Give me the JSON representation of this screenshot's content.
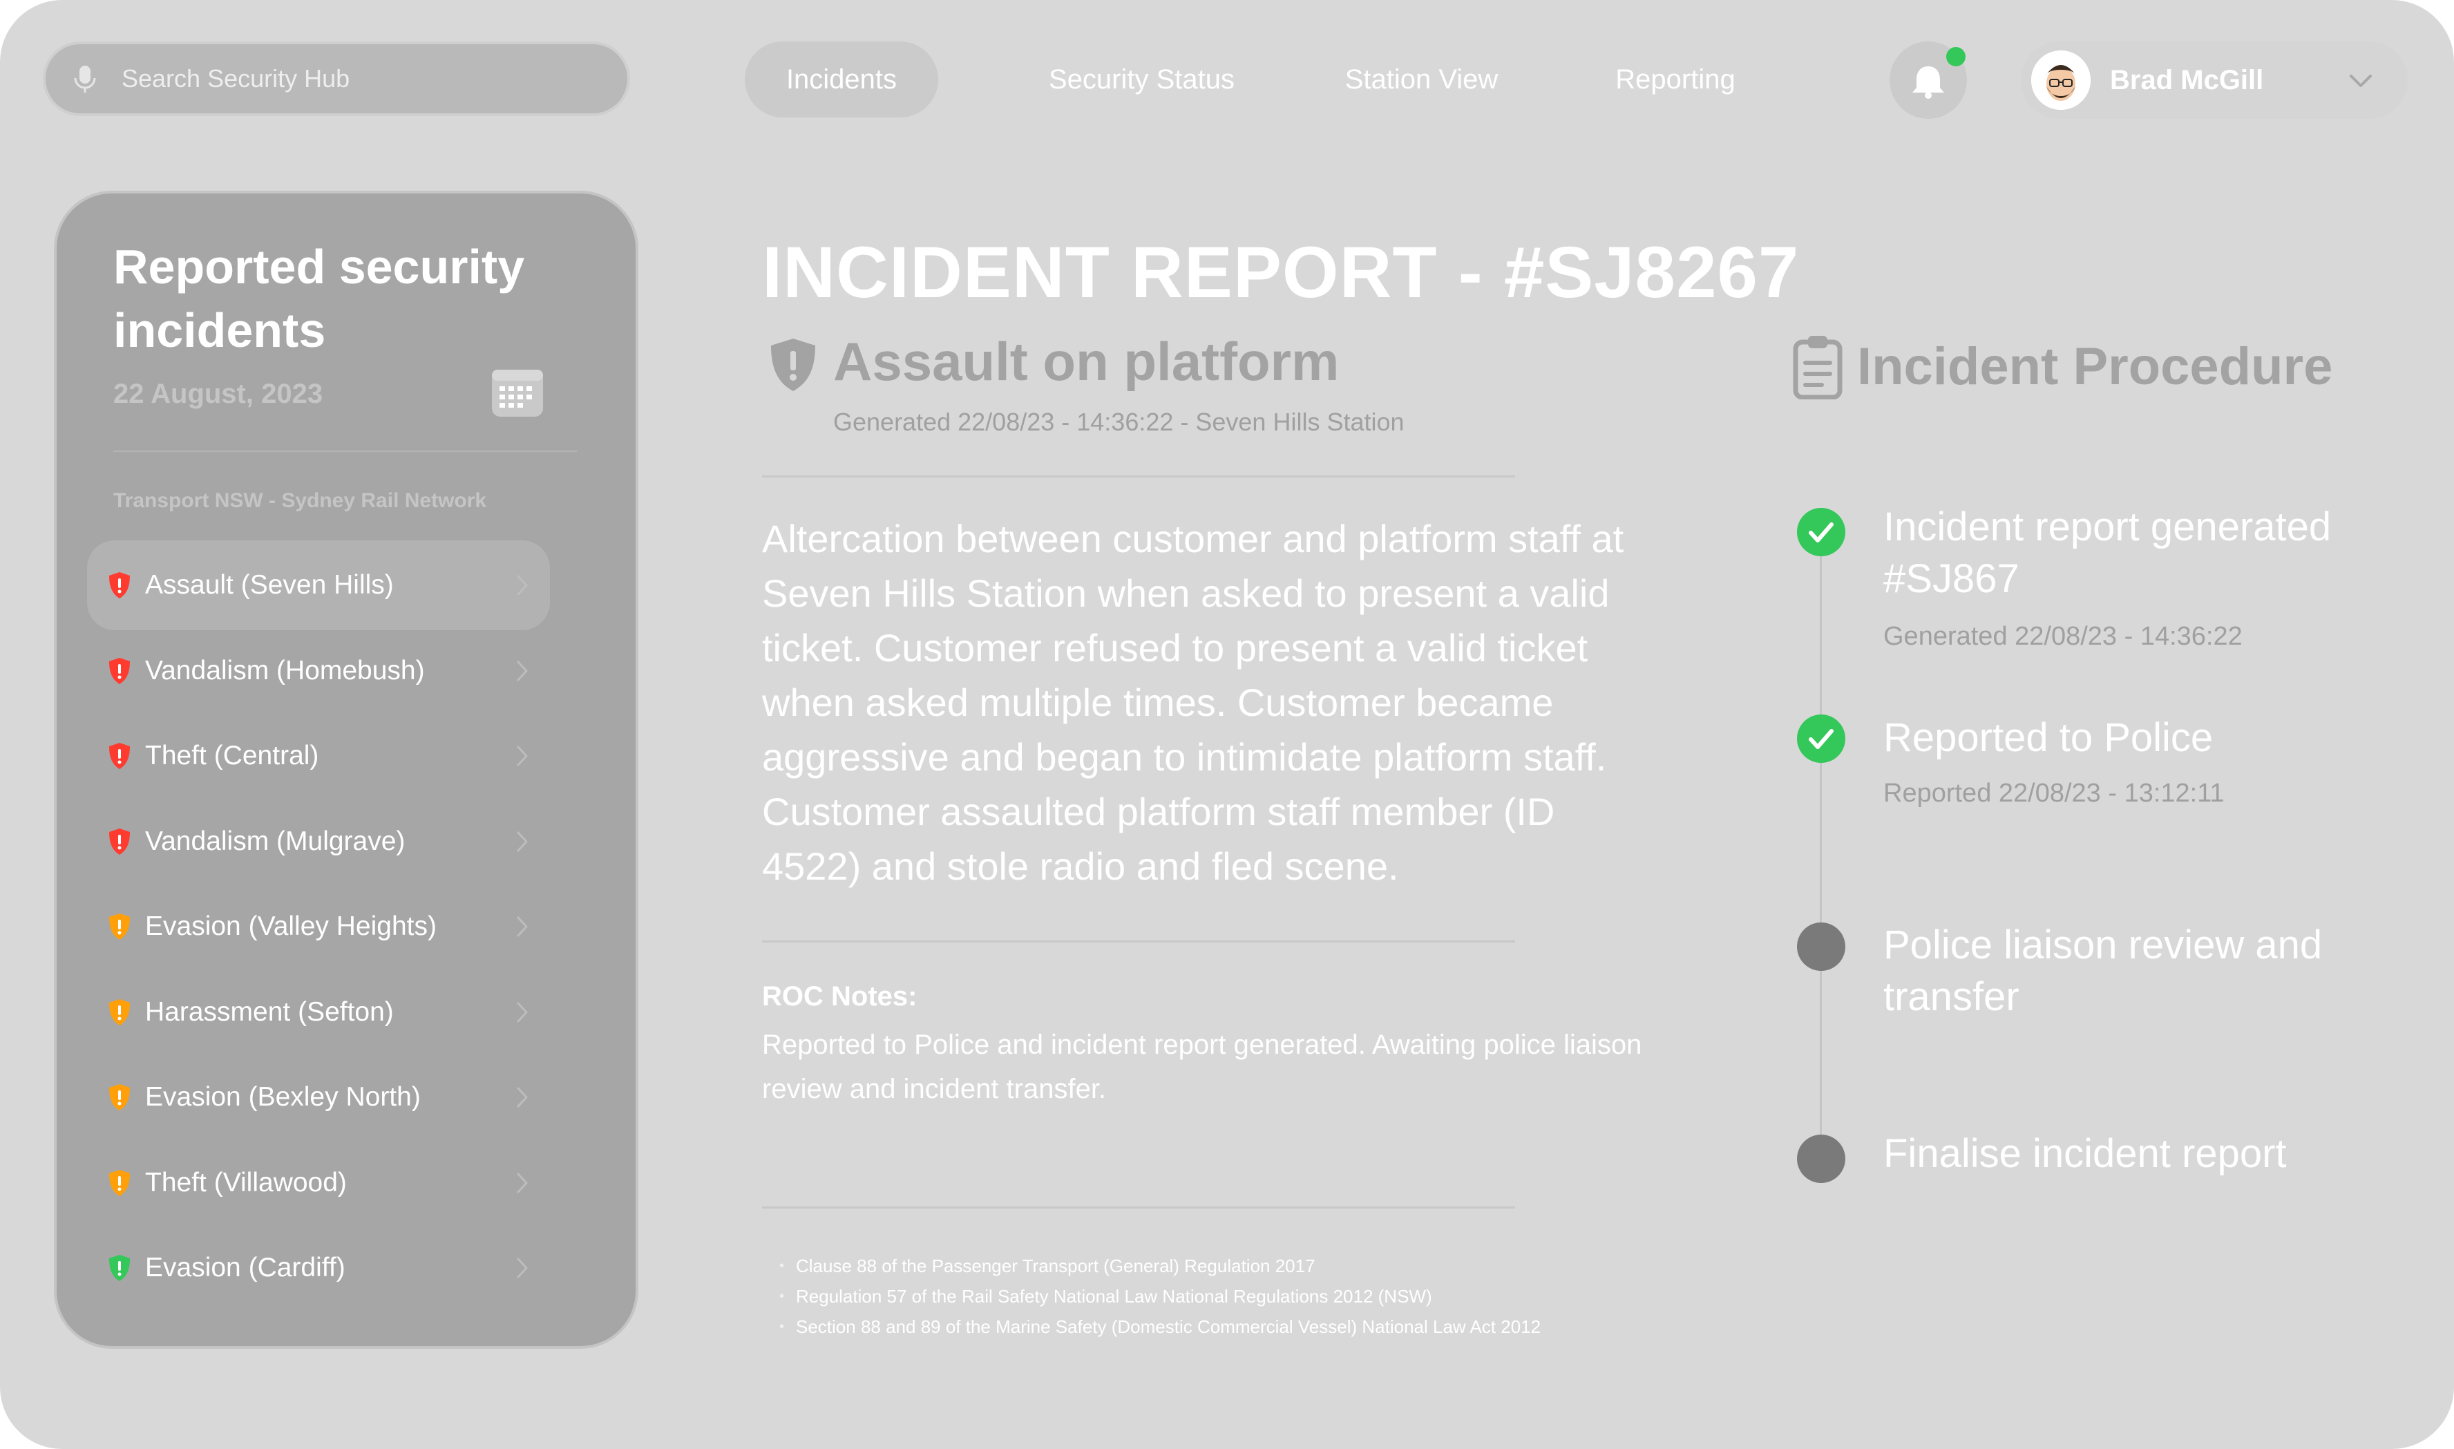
{
  "search": {
    "placeholder": "Search Security Hub"
  },
  "nav": {
    "tabs": [
      {
        "label": "Incidents",
        "active": true
      },
      {
        "label": "Security Status",
        "active": false
      },
      {
        "label": "Station View",
        "active": false
      },
      {
        "label": "Reporting",
        "active": false
      }
    ]
  },
  "user": {
    "name": "Brad McGill"
  },
  "sidebar": {
    "title": "Reported security incidents",
    "date": "22 August, 2023",
    "network": "Transport NSW - Sydney Rail Network",
    "items": [
      {
        "label": "Assault (Seven Hills)",
        "severity": "red",
        "selected": true
      },
      {
        "label": "Vandalism (Homebush)",
        "severity": "red",
        "selected": false
      },
      {
        "label": "Theft (Central)",
        "severity": "red",
        "selected": false
      },
      {
        "label": "Vandalism (Mulgrave)",
        "severity": "red",
        "selected": false
      },
      {
        "label": "Evasion (Valley Heights)",
        "severity": "amber",
        "selected": false
      },
      {
        "label": "Harassment (Sefton)",
        "severity": "amber",
        "selected": false
      },
      {
        "label": "Evasion (Bexley North)",
        "severity": "amber",
        "selected": false
      },
      {
        "label": "Theft (Villawood)",
        "severity": "amber",
        "selected": false
      },
      {
        "label": "Evasion (Cardiff)",
        "severity": "green",
        "selected": false
      }
    ]
  },
  "report": {
    "title": "INCIDENT REPORT - #SJ8267",
    "type": "Assault on platform",
    "generated": "Generated 22/08/23 - 14:36:22  - Seven Hills Station",
    "description": "Altercation between customer and platform staff at Seven Hills Station when asked to present a valid ticket. Customer refused to present a valid ticket when asked multiple times. Customer became aggressive and began to intimidate platform staff. Customer assaulted platform staff member (ID 4522) and stole radio and fled scene.",
    "roc_label": "ROC Notes:",
    "roc_text": "Reported to Police and incident report generated. Awaiting police liaison review and incident transfer.",
    "references": [
      "Clause 88 of the Passenger Transport (General) Regulation 2017",
      "Regulation 57 of the Rail Safety National Law National Regulations 2012 (NSW)",
      "Section 88 and 89 of the Marine Safety (Domestic Commercial Vessel) National Law Act 2012"
    ]
  },
  "procedure": {
    "title": "Incident Procedure",
    "steps": [
      {
        "title": "Incident report generated #SJ867",
        "meta": "Generated 22/08/23 - 14:36:22",
        "done": true
      },
      {
        "title": "Reported to Police",
        "meta": "Reported 22/08/23 - 13:12:11",
        "done": true
      },
      {
        "title": "Police liaison review and transfer",
        "meta": "",
        "done": false
      },
      {
        "title": "Finalise incident report",
        "meta": "",
        "done": false
      }
    ]
  },
  "colors": {
    "severity_red": "#ff3b30",
    "severity_amber": "#ff9f0a",
    "severity_green": "#34c759",
    "step_done": "#34c759",
    "step_todo": "#7a7a7a",
    "notification_dot": "#34c759"
  },
  "icons": {
    "search": "microphone-icon",
    "notifications": "bell-icon",
    "calendar": "calendar-icon",
    "incident": "shield-exclamation-icon",
    "procedure": "clipboard-icon",
    "completed": "checkmark-icon"
  }
}
